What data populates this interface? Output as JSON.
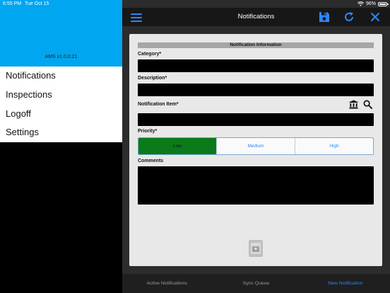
{
  "status_bar": {
    "time": "6:55 PM",
    "date": "Tue Oct 15",
    "battery": "96%"
  },
  "drawer": {
    "version": "AMS v1.0.0.21",
    "menu": [
      {
        "label": "Notifications"
      },
      {
        "label": "Inspections"
      },
      {
        "label": "Logoff"
      },
      {
        "label": "Settings"
      }
    ]
  },
  "navbar": {
    "title": "Notifications"
  },
  "form": {
    "section_title": "Notification Information",
    "category_label": "Category*",
    "description_label": "Description*",
    "notification_item_label": "Notification Item*",
    "priority_label": "Priority*",
    "priority_options": [
      {
        "label": "Low",
        "selected": true
      },
      {
        "label": "Medium",
        "selected": false
      },
      {
        "label": "High",
        "selected": false
      }
    ],
    "comments_label": "Comments"
  },
  "tabs": [
    {
      "label": "Active Notifications",
      "active": false
    },
    {
      "label": "Sync Queue",
      "active": false
    },
    {
      "label": "New Notification",
      "active": true
    }
  ],
  "colors": {
    "accent": "#2e86f5",
    "drawer_header": "#00a6f0",
    "priority_selected": "#0b7a1b"
  }
}
